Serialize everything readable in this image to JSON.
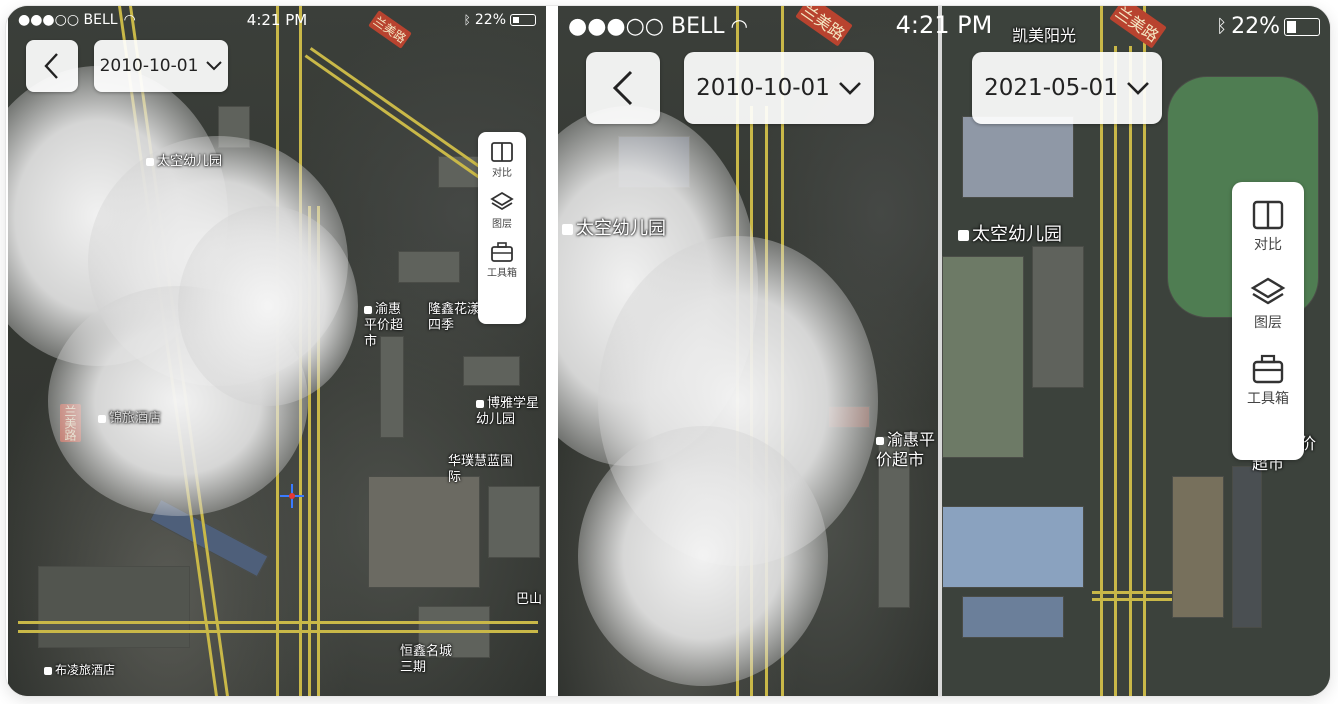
{
  "status_bar": {
    "carrier": "●●●○○ BELL",
    "time": "4:21 PM",
    "battery": "22%"
  },
  "left_panel": {
    "date": "2010-10-01",
    "tools": [
      {
        "icon": "compare-icon",
        "label": "对比"
      },
      {
        "icon": "layers-icon",
        "label": "图层"
      },
      {
        "icon": "toolbox-icon",
        "label": "工具箱"
      }
    ],
    "pois": [
      "太空幼儿园",
      "渝惠平价超市",
      "隆鑫花漾四季",
      "博雅学星幼儿园",
      "华璞慧蓝国际",
      "巴山",
      "恒鑫名城三期",
      "布凌旅酒店",
      "锦旅酒店"
    ],
    "road_label": "兰美路"
  },
  "right_panel": {
    "date_left": "2010-10-01",
    "date_right": "2021-05-01",
    "tools": [
      {
        "icon": "compare-icon",
        "label": "对比"
      },
      {
        "icon": "layers-icon",
        "label": "图层"
      },
      {
        "icon": "toolbox-icon",
        "label": "工具箱"
      }
    ],
    "pois": [
      "太空幼儿园",
      "渝惠平价超市",
      "凯美阳光"
    ],
    "road_label": "兰美路"
  }
}
